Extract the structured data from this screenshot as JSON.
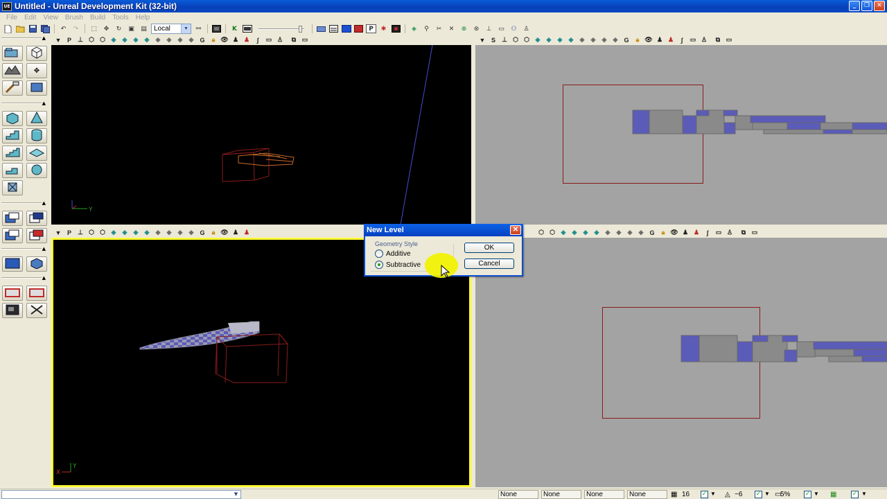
{
  "window": {
    "app_icon": "UE",
    "title": "Untitled - Unreal Development Kit (32-bit)",
    "buttons": {
      "minimize": "_",
      "maximize": "❐",
      "close": "✕"
    }
  },
  "menu": [
    "File",
    "Edit",
    "View",
    "Brush",
    "Build",
    "Tools",
    "Help"
  ],
  "toolbar": {
    "coordinate_system": "Local",
    "icons": [
      "new-icon",
      "open-icon",
      "save-icon",
      "save-all-icon",
      "undo-icon",
      "redo-icon",
      "select-icon",
      "translate-icon",
      "rotate-icon",
      "scale-icon",
      "nonuniform-scale-icon",
      "binoculars-icon",
      "matinee-icon",
      "kismet-icon",
      "content-browser-icon",
      "build-geometry-icon",
      "build-lighting-icon",
      "build-paths-icon",
      "build-all-icon",
      "play-icon",
      "play-on-pc-icon"
    ]
  },
  "viewport_toolbar": {
    "perspective_letter": "P",
    "side_letter": "S",
    "game_letter": "G"
  },
  "axis_labels": {
    "top_left": [
      "X",
      "Y"
    ],
    "bottom_left": [
      "X",
      "Y"
    ]
  },
  "dialog": {
    "title": "New Level",
    "group_label": "Geometry Style",
    "options": [
      {
        "label": "Additive",
        "selected": false
      },
      {
        "label": "Subtractive",
        "selected": true
      }
    ],
    "ok": "OK",
    "cancel": "Cancel"
  },
  "statusbar": {
    "fields": [
      "None",
      "None",
      "None",
      "None"
    ],
    "grid_size": "16",
    "rotation_snap": "~6",
    "scale_snap": "5%"
  },
  "colors": {
    "viewport_bg": "#000000",
    "ortho_bg": "#a3a3a3",
    "brush_red": "#8a1b1b",
    "active_viewport_border": "#ffff33",
    "mesh_blue": "#5b5bb8"
  }
}
